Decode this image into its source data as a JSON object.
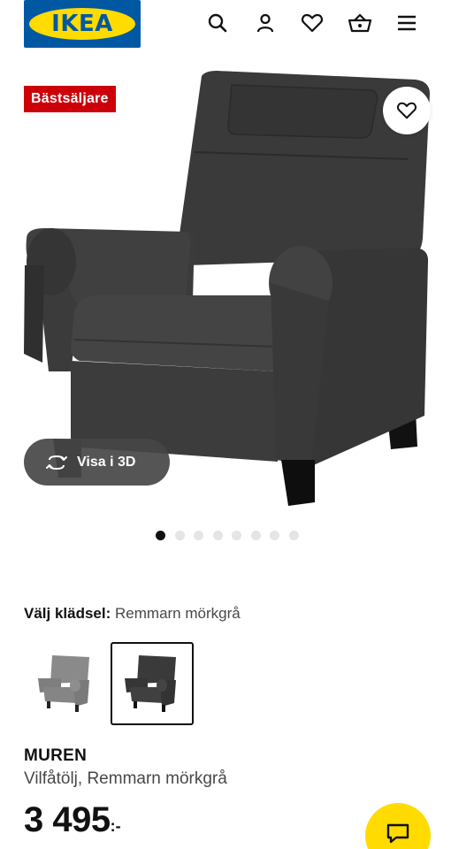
{
  "header": {
    "logo_text": "IKEA",
    "icons": [
      "search-icon",
      "user-icon",
      "heart-icon",
      "basket-icon",
      "menu-icon"
    ]
  },
  "hero": {
    "badge": "Bästsäljare",
    "view_3d_label": "Visa i 3D",
    "image_count": 8,
    "active_image": 1
  },
  "upholstery": {
    "label": "Välj klädsel:",
    "value": "Remmarn mörkgrå",
    "options": [
      {
        "color": "#7d7d7d",
        "selected": false
      },
      {
        "color": "#3a3a3a",
        "selected": true
      }
    ]
  },
  "product": {
    "name": "MUREN",
    "description": "Vilfåtölj, Remmarn mörkgrå",
    "price_integer": "3 495",
    "price_suffix": ":-"
  },
  "colors": {
    "brand_blue": "#0058a3",
    "brand_yellow": "#ffdb00",
    "badge_red": "#cc0008"
  }
}
